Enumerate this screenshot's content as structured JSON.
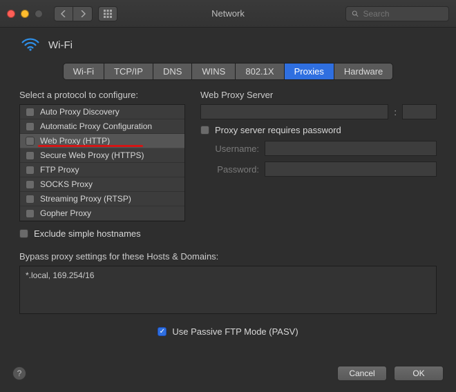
{
  "window": {
    "title": "Network",
    "search_placeholder": "Search"
  },
  "header": {
    "title": "Wi-Fi"
  },
  "tabs": {
    "items": [
      "Wi-Fi",
      "TCP/IP",
      "DNS",
      "WINS",
      "802.1X",
      "Proxies",
      "Hardware"
    ],
    "active": "Proxies"
  },
  "left": {
    "label": "Select a protocol to configure:",
    "protocols": [
      {
        "label": "Auto Proxy Discovery",
        "checked": false,
        "selected": false
      },
      {
        "label": "Automatic Proxy Configuration",
        "checked": false,
        "selected": false
      },
      {
        "label": "Web Proxy (HTTP)",
        "checked": false,
        "selected": true,
        "highlight": true
      },
      {
        "label": "Secure Web Proxy (HTTPS)",
        "checked": false,
        "selected": false
      },
      {
        "label": "FTP Proxy",
        "checked": false,
        "selected": false
      },
      {
        "label": "SOCKS Proxy",
        "checked": false,
        "selected": false
      },
      {
        "label": "Streaming Proxy (RTSP)",
        "checked": false,
        "selected": false
      },
      {
        "label": "Gopher Proxy",
        "checked": false,
        "selected": false
      }
    ],
    "exclude_label": "Exclude simple hostnames"
  },
  "right": {
    "title": "Web Proxy Server",
    "host": "",
    "port": "",
    "requires_password_label": "Proxy server requires password",
    "username_label": "Username:",
    "password_label": "Password:"
  },
  "bypass": {
    "label": "Bypass proxy settings for these Hosts & Domains:",
    "value": "*.local, 169.254/16"
  },
  "passive": {
    "label": "Use Passive FTP Mode (PASV)",
    "checked": true
  },
  "footer": {
    "cancel": "Cancel",
    "ok": "OK"
  },
  "colors": {
    "accent": "#2f6fe0",
    "highlight_red": "#d51515"
  }
}
